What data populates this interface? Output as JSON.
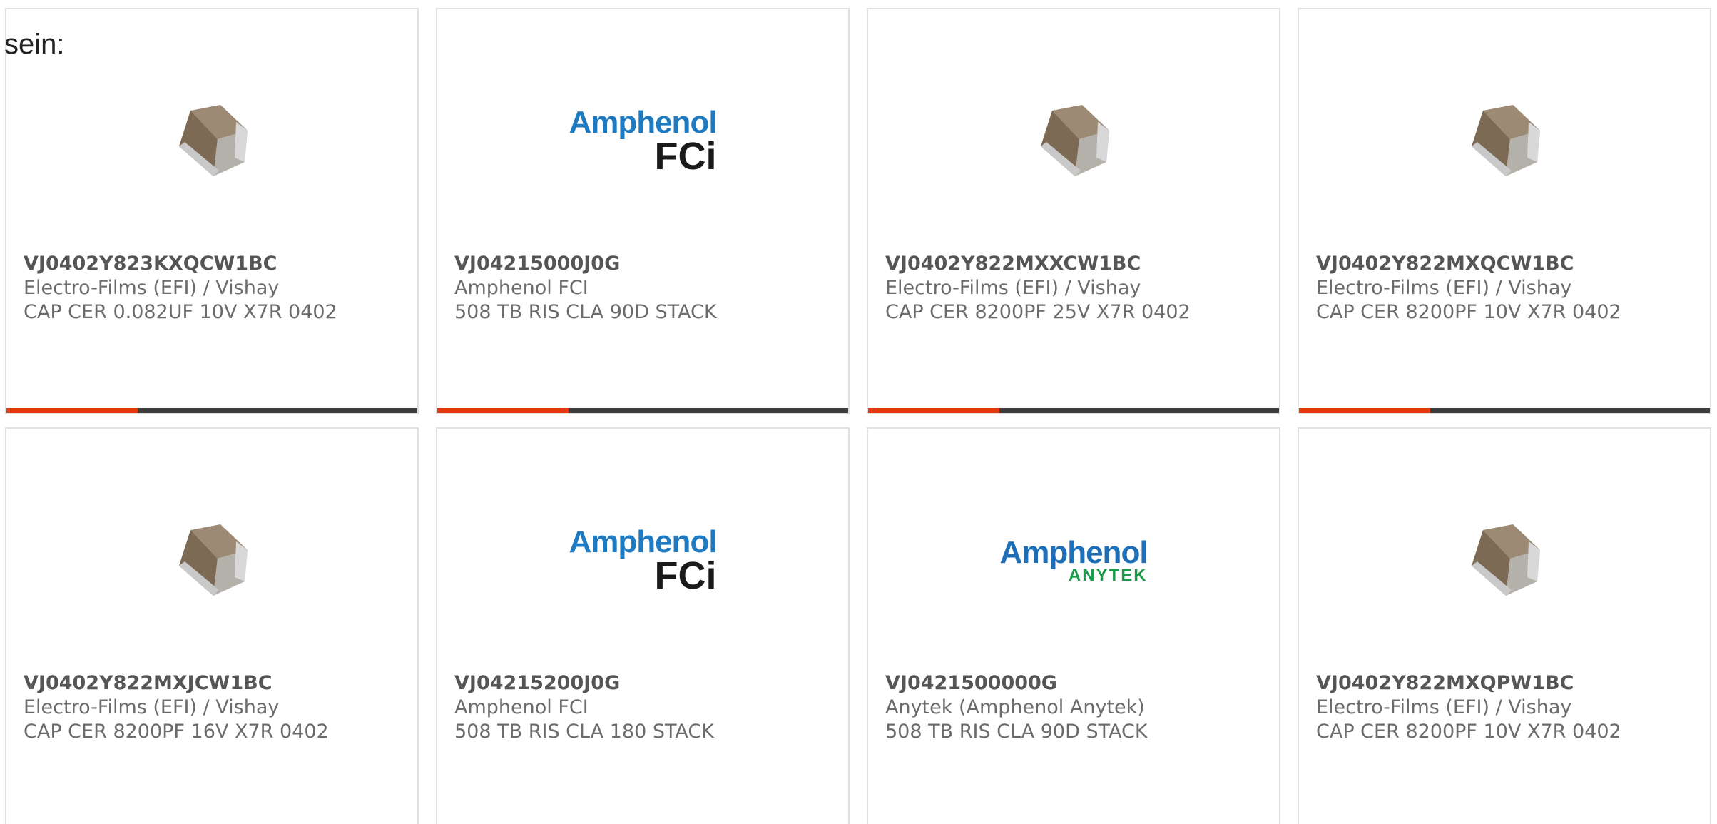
{
  "intro_text": "sein:",
  "colors": {
    "accent_bar": "#e03a0d",
    "bar_track": "#3d3d3d",
    "card_border": "#e0e0e0"
  },
  "cards": [
    {
      "part_number": "VJ0402Y823KXQCW1BC",
      "manufacturer": "Electro-Films (EFI) / Vishay",
      "description": "CAP CER 0.082UF 10V X7R 0402",
      "image": "ceramic-chip-capacitor",
      "progress": 0.32
    },
    {
      "part_number": "VJ04215000J0G",
      "manufacturer": "Amphenol FCI",
      "description": "508 TB RIS CLA 90D STACK",
      "image": "amphenol-fci-logo",
      "logo_brand": "Amphenol",
      "logo_sub": "FCi",
      "progress": 0.32
    },
    {
      "part_number": "VJ0402Y822MXXCW1BC",
      "manufacturer": "Electro-Films (EFI) / Vishay",
      "description": "CAP CER 8200PF 25V X7R 0402",
      "image": "ceramic-chip-capacitor",
      "progress": 0.32
    },
    {
      "part_number": "VJ0402Y822MXQCW1BC",
      "manufacturer": "Electro-Films (EFI) / Vishay",
      "description": "CAP CER 8200PF 10V X7R 0402",
      "image": "ceramic-chip-capacitor",
      "progress": 0.32
    },
    {
      "part_number": "VJ0402Y822MXJCW1BC",
      "manufacturer": "Electro-Films (EFI) / Vishay",
      "description": "CAP CER 8200PF 16V X7R 0402",
      "image": "ceramic-chip-capacitor"
    },
    {
      "part_number": "VJ04215200J0G",
      "manufacturer": "Amphenol FCI",
      "description": "508 TB RIS CLA 180 STACK",
      "image": "amphenol-fci-logo",
      "logo_brand": "Amphenol",
      "logo_sub": "FCi"
    },
    {
      "part_number": "VJ0421500000G",
      "manufacturer": "Anytek (Amphenol Anytek)",
      "description": "508 TB RIS CLA 90D STACK",
      "image": "amphenol-anytek-logo",
      "logo_brand": "Amphenol",
      "logo_sub": "ANYTEK"
    },
    {
      "part_number": "VJ0402Y822MXQPW1BC",
      "manufacturer": "Electro-Films (EFI) / Vishay",
      "description": "CAP CER 8200PF 10V X7R 0402",
      "image": "ceramic-chip-capacitor"
    }
  ]
}
